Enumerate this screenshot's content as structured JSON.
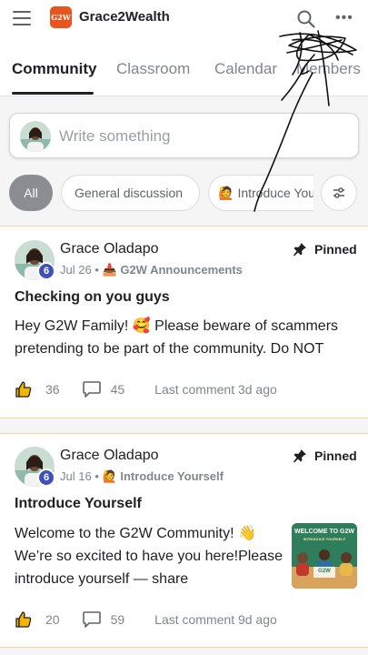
{
  "app": {
    "name": "Grace2Wealth",
    "logo_text": "G2W"
  },
  "icons": {
    "menu": "hamburger-menu-icon",
    "search": "search-icon",
    "more": "more-horizontal-icon",
    "filter": "filter-sliders-icon",
    "pin": "pin-icon",
    "like": "thumbs-up-icon",
    "comment": "comment-bubble-icon"
  },
  "colors": {
    "brand": "#e8561f",
    "badge": "#3f51b5",
    "card_border": "#f3d3a0",
    "active_chip": "#8a8d91"
  },
  "tabs": [
    {
      "label": "Community",
      "active": true
    },
    {
      "label": "Classroom",
      "active": false
    },
    {
      "label": "Calendar",
      "active": false
    },
    {
      "label": "Members",
      "active": false
    }
  ],
  "composer": {
    "placeholder": "Write something"
  },
  "filters": {
    "chips": [
      {
        "label": "All",
        "active": true,
        "emoji": ""
      },
      {
        "label": "General discussion",
        "active": false,
        "emoji": ""
      },
      {
        "label": "Introduce Yourself",
        "active": false,
        "emoji": "🙋"
      }
    ]
  },
  "posts": [
    {
      "author": "Grace Oladapo",
      "level": "6",
      "date": "Jul 26",
      "separator": "•",
      "category_emoji": "📥",
      "category": "G2W Announcements",
      "pinned_label": "Pinned",
      "title": "Checking on you guys",
      "body": "Hey G2W Family! 🥰 Please beware of scammers pretending to be part of the community. Do NOT",
      "likes": "36",
      "comments": "45",
      "last_comment": "Last comment 3d ago"
    },
    {
      "author": "Grace Oladapo",
      "level": "6",
      "date": "Jul 16",
      "separator": "•",
      "category_emoji": "🙋",
      "category": "Introduce Yourself",
      "pinned_label": "Pinned",
      "title": "Introduce Yourself",
      "body": "Welcome to the G2W Community! 👋 We’re so excited to have you here!Please introduce yourself — share",
      "likes": "20",
      "comments": "59",
      "last_comment": "Last comment 9d ago",
      "thumbnail": {
        "headline": "WELCOME TO G2W",
        "subline": "INTRODUCE YOURSELF",
        "sign": "G2W"
      }
    }
  ]
}
